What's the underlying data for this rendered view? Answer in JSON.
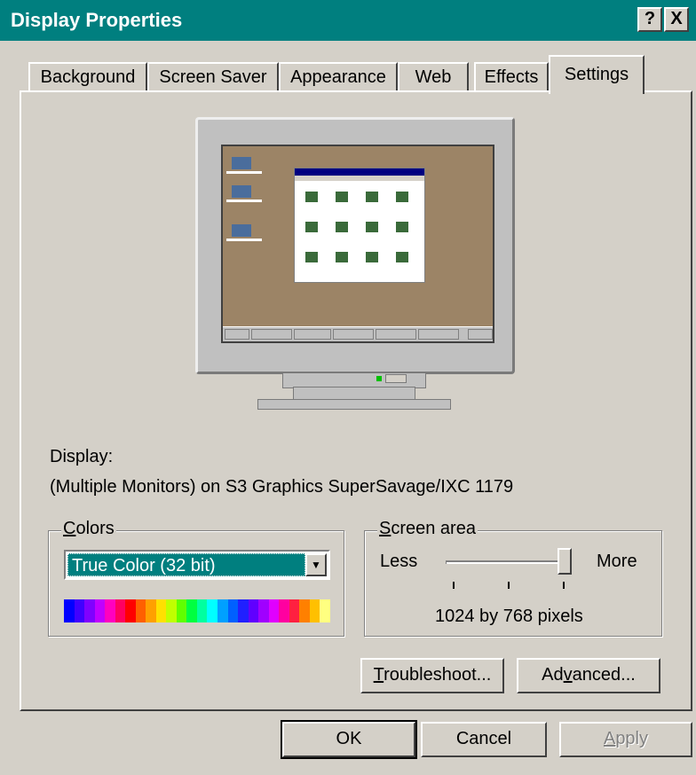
{
  "window": {
    "title": "Display Properties",
    "help_label": "?",
    "close_label": "X"
  },
  "tabs": [
    {
      "label": "Background"
    },
    {
      "label": "Screen Saver"
    },
    {
      "label": "Appearance"
    },
    {
      "label": "Web"
    },
    {
      "label": "Effects"
    },
    {
      "label": "Settings",
      "active": true
    }
  ],
  "display": {
    "label": "Display:",
    "value": "(Multiple Monitors) on S3 Graphics SuperSavage/IXC 1179"
  },
  "colors": {
    "label": "Colors",
    "selected": "True Color (32 bit)"
  },
  "screen_area": {
    "label": "Screen area",
    "less_label": "Less",
    "more_label": "More",
    "resolution": "1024 by 768 pixels",
    "slider_level": 1.0
  },
  "buttons": {
    "troubleshoot": "Troubleshoot...",
    "advanced": "Advanced...",
    "ok": "OK",
    "cancel": "Cancel",
    "apply": "Apply"
  },
  "colors_accent": {
    "title_bar": "#007f7f",
    "selection": "#007f7f",
    "face": "#d4d0c8"
  }
}
